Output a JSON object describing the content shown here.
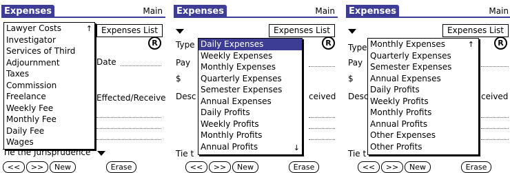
{
  "app": {
    "title": "Expenses",
    "main_label": "Main",
    "list_button": "Expenses List",
    "r_badge": "R"
  },
  "form": {
    "type_label": "Type",
    "pay_label": "Pay",
    "currency_label": "$",
    "desc_label": "Desc",
    "date_label": "Date",
    "effected_received_label": "Effected/Received",
    "received_label": "ceived",
    "tie_label": "Tie the Jurisprudence",
    "tie_label_short": "Tie t"
  },
  "buttons": {
    "prev": "<<",
    "next": ">>",
    "new": "(New)",
    "new_plain": "New",
    "erase": "Erase"
  },
  "screens": [
    {
      "popup_items": [
        "Lawyer Costs",
        "Investigator",
        "Services of Third",
        "Adjournment",
        "Taxes",
        "Commission",
        "Freelance",
        "Weekly Fee",
        "Monthly Fee",
        "Daily Fee",
        "Wages"
      ],
      "selected_index": -1,
      "scroll_up": "↑",
      "scroll_down": ""
    },
    {
      "popup_items": [
        "Daily Expenses",
        "Weekly Expenses",
        "Monthly Expenses",
        "Quarterly Expenses",
        "Semester Expenses",
        "Annual Expenses",
        "Daily Profits",
        "Weekly Profits",
        "Monthly Profits",
        "Annual Profits"
      ],
      "selected_index": 0,
      "scroll_up": "",
      "scroll_down": "↓"
    },
    {
      "popup_items": [
        "Monthly Expenses",
        "Quarterly Expenses",
        "Semester Expenses",
        "Annual Expenses",
        "Daily Profits",
        "Weekly Profits",
        "Monthly Profits",
        "Annual Profits",
        "Other Expenses",
        "Other Profits"
      ],
      "selected_index": -1,
      "scroll_up": "↑",
      "scroll_down": ""
    }
  ]
}
